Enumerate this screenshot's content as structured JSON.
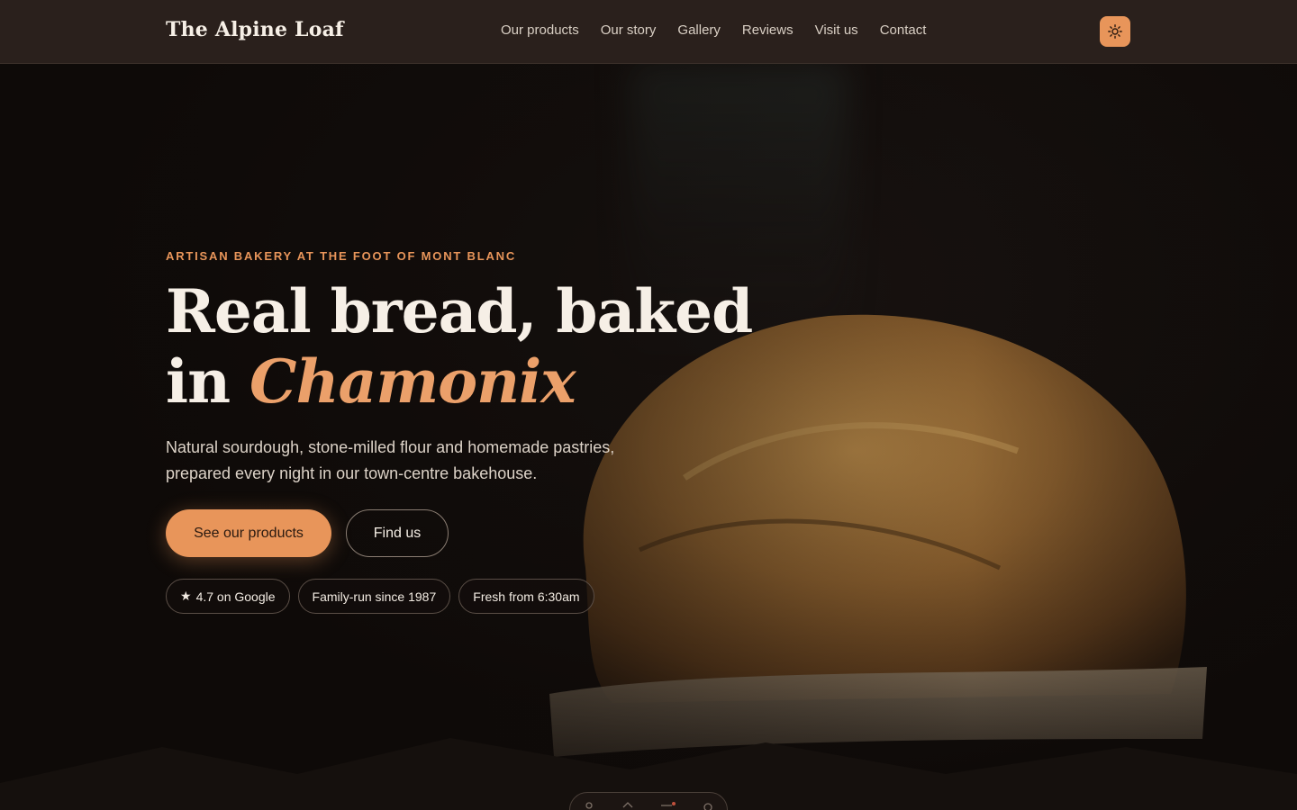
{
  "header": {
    "brand": "The Alpine Loaf",
    "nav": [
      "Our products",
      "Our story",
      "Gallery",
      "Reviews",
      "Visit us",
      "Contact"
    ],
    "theme_toggle_icon": "sun-icon"
  },
  "hero": {
    "eyebrow": "ARTISAN BAKERY AT THE FOOT OF MONT BLANC",
    "headline_line1": "Real bread, baked",
    "headline_in": "in ",
    "headline_accent": "Chamonix",
    "lede": "Natural sourdough, stone-milled flour and homemade pastries, prepared every night in our town-centre bakehouse.",
    "cta_primary": "See our products",
    "cta_secondary": "Find us",
    "chips": [
      {
        "icon": "star-icon",
        "label": "4.7 on Google"
      },
      {
        "label": "Family-run since 1987"
      },
      {
        "label": "Fresh from 6:30am"
      }
    ]
  },
  "colors": {
    "accent": "#e8955a",
    "header_bg": "#2a201c",
    "page_bg": "#0f0b09"
  }
}
